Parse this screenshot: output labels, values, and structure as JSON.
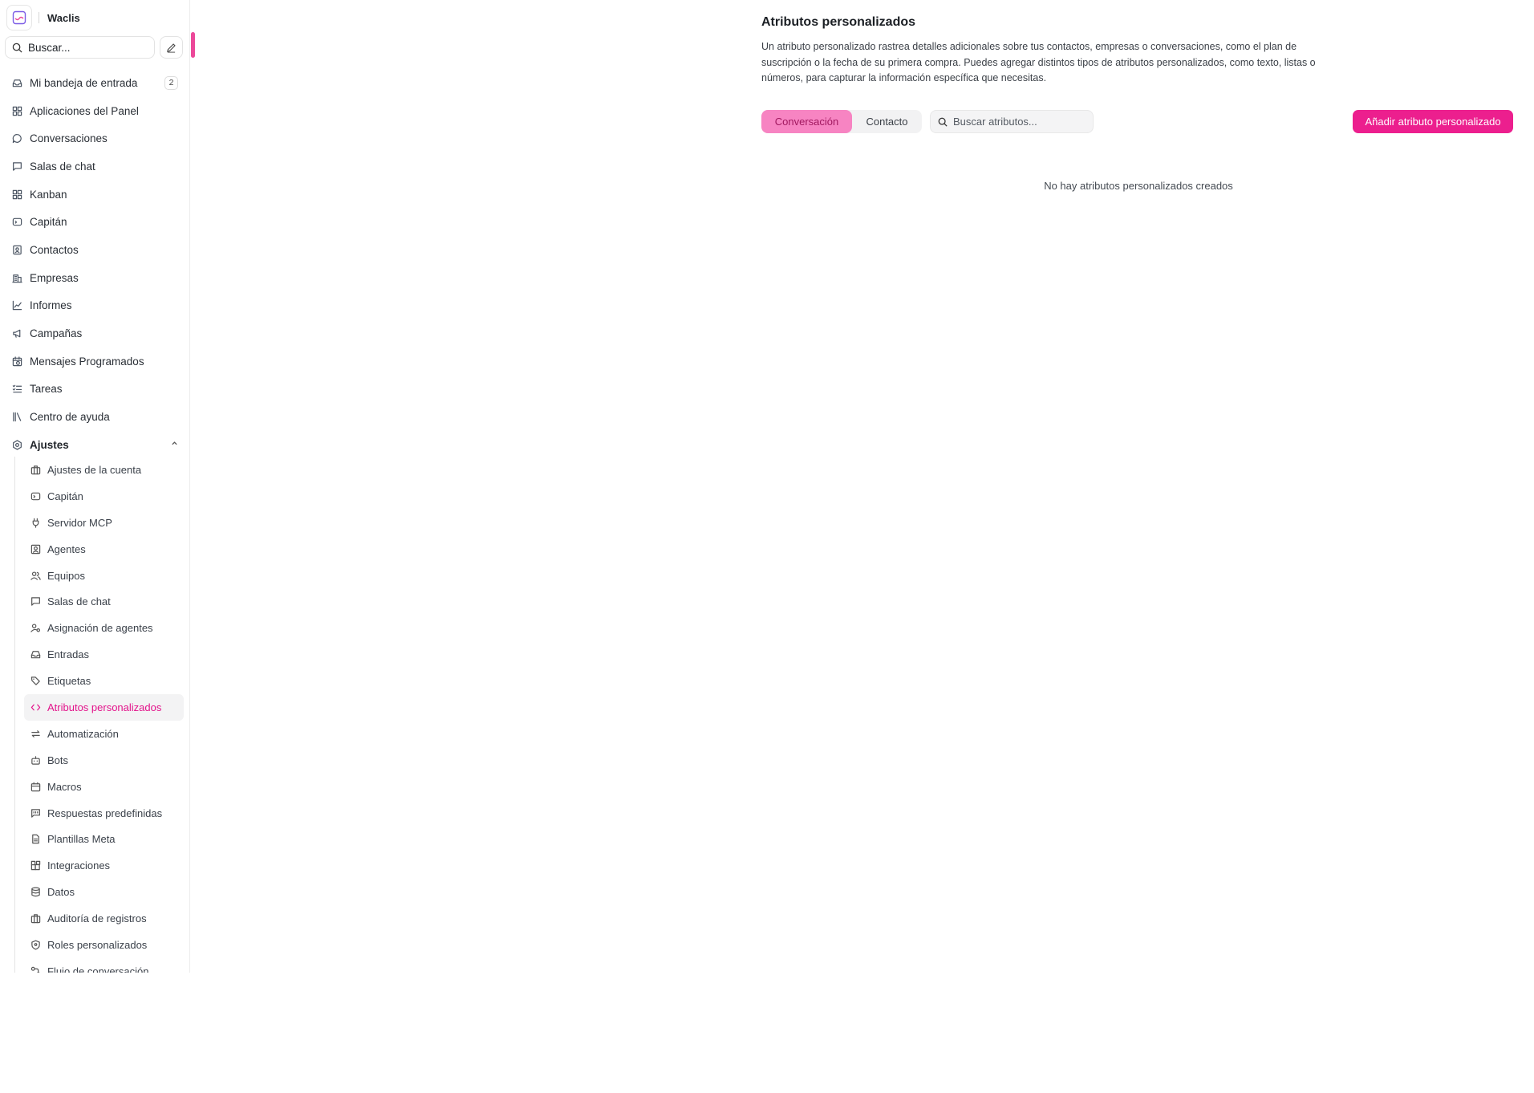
{
  "sidebar": {
    "brand_name": "Waclis",
    "search_label": "Buscar...",
    "nav": [
      {
        "label": "Mi bandeja de entrada",
        "icon": "inbox-icon",
        "badge": "2"
      },
      {
        "label": "Aplicaciones del Panel",
        "icon": "grid-icon"
      },
      {
        "label": "Conversaciones",
        "icon": "chat-bubble-icon"
      },
      {
        "label": "Salas de chat",
        "icon": "message-square-icon"
      },
      {
        "label": "Kanban",
        "icon": "kanban-icon"
      },
      {
        "label": "Capitán",
        "icon": "captain-icon"
      },
      {
        "label": "Contactos",
        "icon": "contact-book-icon"
      },
      {
        "label": "Empresas",
        "icon": "building-icon"
      },
      {
        "label": "Informes",
        "icon": "line-chart-icon"
      },
      {
        "label": "Campañas",
        "icon": "megaphone-icon"
      },
      {
        "label": "Mensajes Programados",
        "icon": "calendar-clock-icon"
      },
      {
        "label": "Tareas",
        "icon": "checklist-icon"
      },
      {
        "label": "Centro de ayuda",
        "icon": "library-icon"
      },
      {
        "label": "Ajustes",
        "icon": "settings-icon"
      }
    ],
    "settings_items": [
      {
        "label": "Ajustes de la cuenta",
        "icon": "briefcase-icon"
      },
      {
        "label": "Capitán",
        "icon": "captain-icon"
      },
      {
        "label": "Servidor MCP",
        "icon": "plug-icon"
      },
      {
        "label": "Agentes",
        "icon": "user-square-icon"
      },
      {
        "label": "Equipos",
        "icon": "users-icon"
      },
      {
        "label": "Salas de chat",
        "icon": "message-square-icon"
      },
      {
        "label": "Asignación de agentes",
        "icon": "user-cog-icon"
      },
      {
        "label": "Entradas",
        "icon": "inbox-icon"
      },
      {
        "label": "Etiquetas",
        "icon": "tags-icon"
      },
      {
        "label": "Atributos personalizados",
        "icon": "code-icon"
      },
      {
        "label": "Automatización",
        "icon": "repeat-icon"
      },
      {
        "label": "Bots",
        "icon": "bot-icon"
      },
      {
        "label": "Macros",
        "icon": "macro-icon"
      },
      {
        "label": "Respuestas predefinidas",
        "icon": "canned-reply-icon"
      },
      {
        "label": "Plantillas Meta",
        "icon": "file-text-icon"
      },
      {
        "label": "Integraciones",
        "icon": "puzzle-icon"
      },
      {
        "label": "Datos",
        "icon": "database-icon"
      },
      {
        "label": "Auditoría de registros",
        "icon": "briefcase-icon"
      },
      {
        "label": "Roles personalizados",
        "icon": "shield-icon"
      },
      {
        "label": "Flujo de conversación",
        "icon": "workflow-icon"
      }
    ]
  },
  "main": {
    "title": "Atributos personalizados",
    "description": "Un atributo personalizado rastrea detalles adicionales sobre tus contactos, empresas o conversaciones, como el plan de suscripción o la fecha de su primera compra. Puedes agregar distintos tipos de atributos personalizados, como texto, listas o números, para capturar la información específica que necesitas.",
    "tabs": [
      {
        "label": "Conversación",
        "active": true
      },
      {
        "label": "Contacto",
        "active": false
      }
    ],
    "search_placeholder": "Buscar atributos...",
    "add_button": "Añadir atributo personalizado",
    "empty_message": "No hay atributos personalizados creados"
  },
  "colors": {
    "accent": "#ec1f8e",
    "active_tab_bg": "#f784c2",
    "active_nav_text": "#e3148b"
  }
}
